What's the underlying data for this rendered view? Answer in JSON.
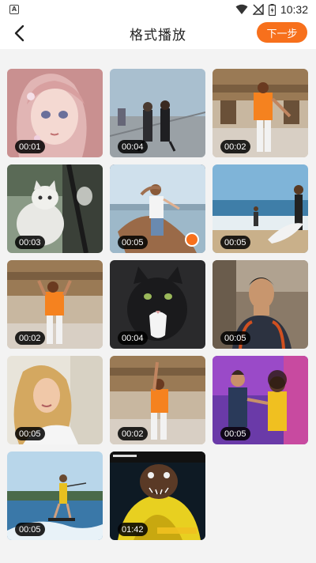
{
  "status_bar": {
    "notification_icon": "A",
    "time": "10:32",
    "icons": [
      "wifi-icon",
      "signal-off-icon",
      "battery-icon"
    ]
  },
  "header": {
    "title": "格式播放",
    "next_label": "下一步",
    "back_icon": "chevron-left-icon"
  },
  "colors": {
    "accent": "#f7701c"
  },
  "videos": [
    {
      "duration": "00:01",
      "subject": "anime-girl",
      "selected": false
    },
    {
      "duration": "00:04",
      "subject": "couple-walking",
      "selected": false
    },
    {
      "duration": "00:02",
      "subject": "dancer-orange",
      "selected": false
    },
    {
      "duration": "00:03",
      "subject": "white-cat",
      "selected": false
    },
    {
      "duration": "00:05",
      "subject": "woman-lake",
      "selected": true
    },
    {
      "duration": "00:05",
      "subject": "surfer-beach",
      "selected": false
    },
    {
      "duration": "00:02",
      "subject": "dancer-orange",
      "selected": false
    },
    {
      "duration": "00:04",
      "subject": "black-cat",
      "selected": false
    },
    {
      "duration": "00:05",
      "subject": "tattooed-man",
      "selected": false
    },
    {
      "duration": "00:05",
      "subject": "blonde-woman",
      "selected": false
    },
    {
      "duration": "00:02",
      "subject": "dancer-orange",
      "selected": false
    },
    {
      "duration": "00:05",
      "subject": "dancing-couple",
      "selected": false
    },
    {
      "duration": "00:05",
      "subject": "wakeboarder",
      "selected": false
    },
    {
      "duration": "01:42",
      "subject": "cartoon-creature",
      "selected": false
    }
  ]
}
